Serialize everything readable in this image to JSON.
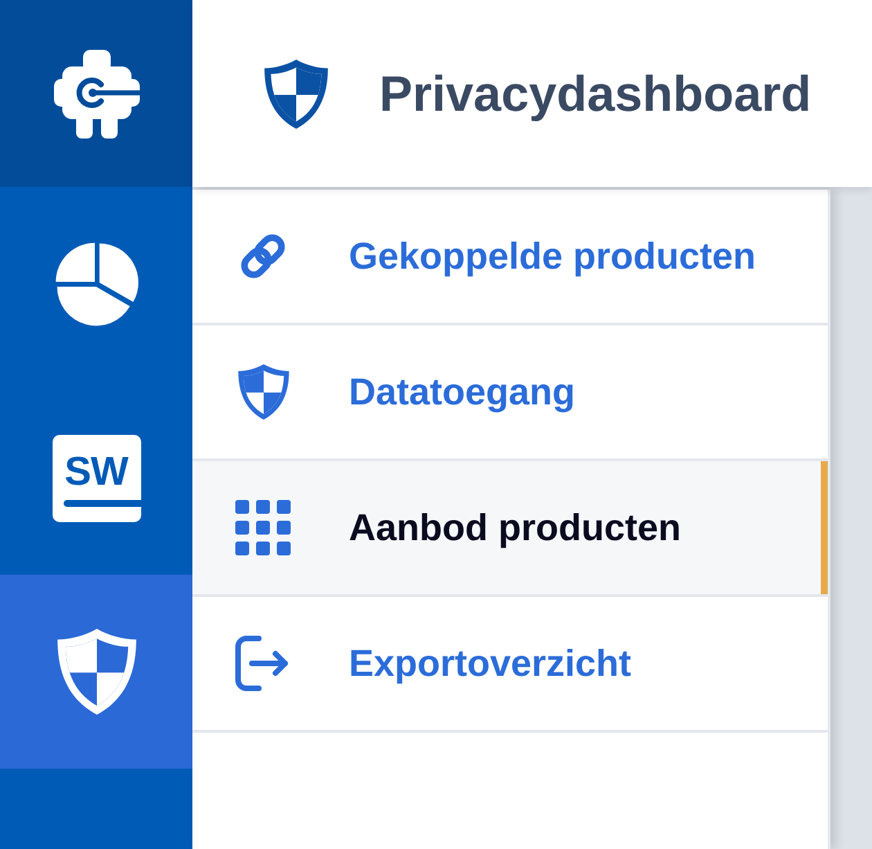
{
  "sidebar": {
    "items": [
      {
        "selected": false
      },
      {
        "selected": false,
        "logo_text": "SW"
      },
      {
        "selected": true
      }
    ]
  },
  "header": {
    "title": "Privacydashboard"
  },
  "menu": {
    "items": [
      {
        "label": "Gekoppelde producten",
        "selected": false
      },
      {
        "label": "Datatoegang",
        "selected": false
      },
      {
        "label": "Aanbod producten",
        "selected": true
      },
      {
        "label": "Exportoverzicht",
        "selected": false
      }
    ]
  }
}
